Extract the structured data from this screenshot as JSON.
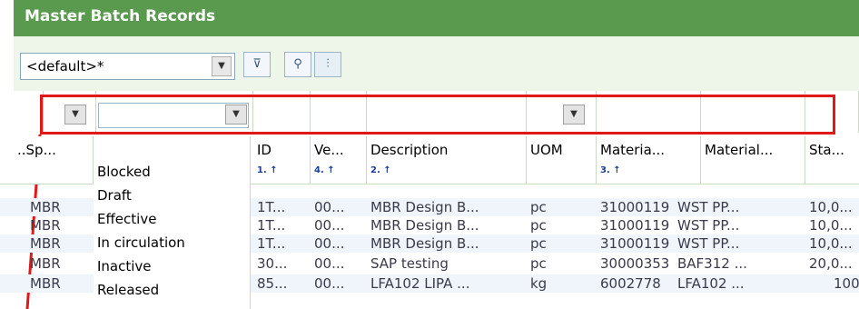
{
  "window": {
    "title": "Master Batch Records"
  },
  "toolbar": {
    "layout_select": "<default>*",
    "buttons": [
      "filter-settings-icon",
      "search-icon",
      "filter-icon"
    ]
  },
  "columns": [
    {
      "label": "..Sp...",
      "sort": ""
    },
    {
      "label": "ID",
      "sort": "1. ↑"
    },
    {
      "label": "Ve...",
      "sort": "4. ↑"
    },
    {
      "label": "Description",
      "sort": "2. ↑"
    },
    {
      "label": "UOM",
      "sort": ""
    },
    {
      "label": "Materia...",
      "sort": "3. ↑"
    },
    {
      "label": "Material...",
      "sort": ""
    },
    {
      "label": "Sta...",
      "sort": ""
    }
  ],
  "status_options": [
    "Blocked",
    "Draft",
    "Effective",
    "In circulation",
    "Inactive",
    "Released"
  ],
  "rows": [
    {
      "sp": "MBR",
      "id": "1T...",
      "ver": "00...",
      "desc": "MBR Design B...",
      "uom": "pc",
      "mat": "31000119",
      "matname": "WST PP...",
      "sta": "10,0..."
    },
    {
      "sp": "MBR",
      "id": "1T...",
      "ver": "00...",
      "desc": "MBR Design B...",
      "uom": "pc",
      "mat": "31000119",
      "matname": "WST PP...",
      "sta": "10,0..."
    },
    {
      "sp": "MBR",
      "id": "1T...",
      "ver": "00...",
      "desc": "MBR Design B...",
      "uom": "pc",
      "mat": "31000119",
      "matname": "WST PP...",
      "sta": "10,0..."
    },
    {
      "sp": "MBR",
      "id": "30...",
      "ver": "00...",
      "desc": "SAP testing",
      "uom": "pc",
      "mat": "30000353",
      "matname": "BAF312 ...",
      "sta": "20,0..."
    },
    {
      "sp": "MBR",
      "id": "85...",
      "ver": "00...",
      "desc": "LFA102 LIPA ...",
      "uom": "kg",
      "mat": "6002778",
      "matname": "LFA102 ...",
      "sta": "100"
    }
  ]
}
